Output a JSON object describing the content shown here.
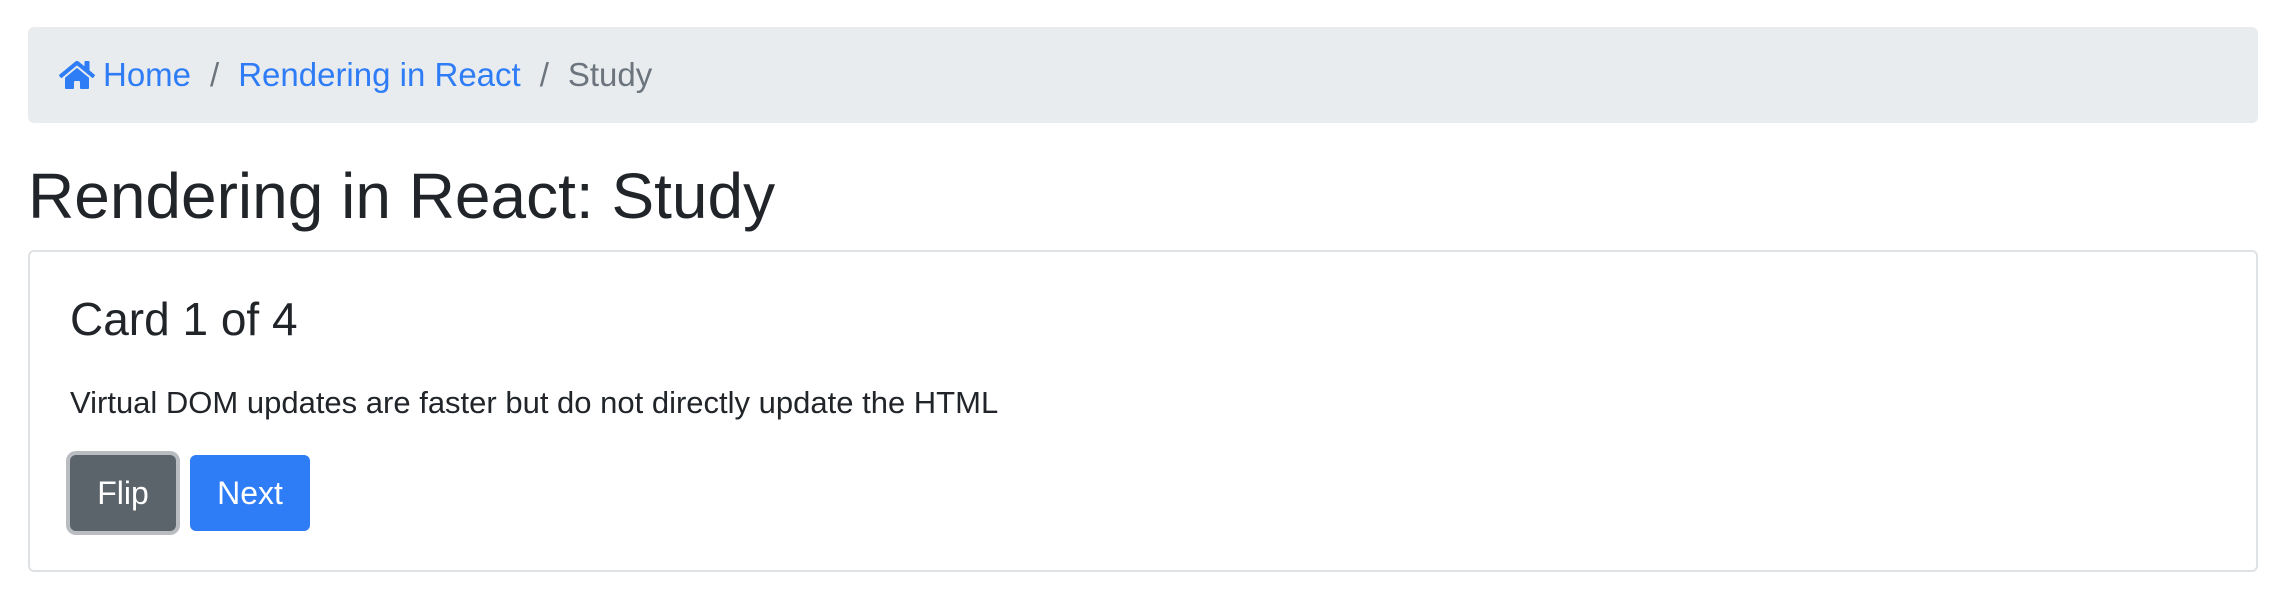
{
  "breadcrumb": {
    "home_icon": "home-icon",
    "home_label": "Home",
    "section_label": "Rendering in React",
    "current_label": "Study",
    "separator": "/"
  },
  "page": {
    "title": "Rendering in React: Study"
  },
  "card": {
    "title": "Card 1 of 4",
    "text": "Virtual DOM updates are faster but do not directly update the HTML",
    "flip_label": "Flip",
    "next_label": "Next"
  },
  "colors": {
    "link": "#2f7df6",
    "breadcrumb_bg": "#e9ecef",
    "flip_button": "#5b636b",
    "next_button": "#2f7df6"
  }
}
